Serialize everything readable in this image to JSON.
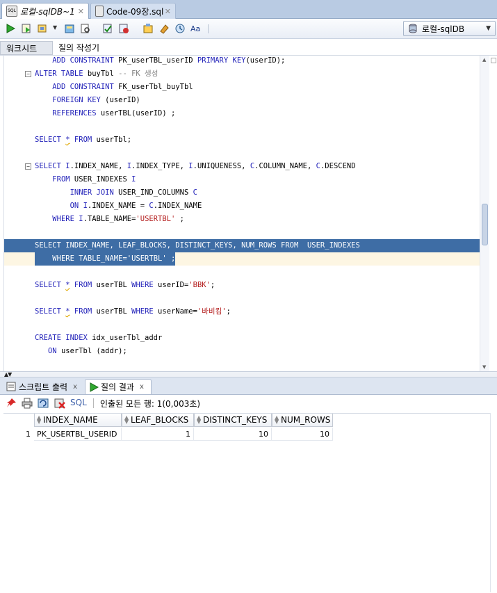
{
  "tabs": [
    {
      "label": "로컬-sqlDB~1",
      "active": true
    },
    {
      "label": "Code-09장.sql",
      "active": false
    }
  ],
  "toolbar": {
    "connection": "로컬-sqlDB"
  },
  "subtabs": [
    "워크시트",
    "질의 작성기"
  ],
  "editor": {
    "lines": [
      {
        "segs": [
          [
            "",
            "    "
          ],
          [
            "kw",
            "ADD CONSTRAINT"
          ],
          [
            "",
            " PK_userTBL_userID "
          ],
          [
            "kw",
            "PRIMARY KEY"
          ],
          [
            "",
            "(userID);"
          ]
        ]
      },
      {
        "fold": true,
        "segs": [
          [
            "kw",
            "ALTER TABLE"
          ],
          [
            "",
            " buyTbl "
          ],
          [
            "cmt",
            "-- FK 생성"
          ]
        ]
      },
      {
        "segs": [
          [
            "",
            "    "
          ],
          [
            "kw",
            "ADD CONSTRAINT"
          ],
          [
            "",
            " FK_userTbl_buyTbl"
          ]
        ]
      },
      {
        "segs": [
          [
            "",
            "    "
          ],
          [
            "kw",
            "FOREIGN KEY"
          ],
          [
            "",
            " (userID)"
          ]
        ]
      },
      {
        "segs": [
          [
            "",
            "    "
          ],
          [
            "kw",
            "REFERENCES"
          ],
          [
            "",
            " userTBL(userID) ;"
          ]
        ]
      },
      {
        "segs": []
      },
      {
        "segs": [
          [
            "kw",
            "SELECT"
          ],
          [
            "",
            " "
          ],
          [
            "star",
            "*"
          ],
          [
            "",
            " "
          ],
          [
            "kw",
            "FROM"
          ],
          [
            "",
            " userTbl;"
          ]
        ]
      },
      {
        "segs": []
      },
      {
        "fold": true,
        "segs": [
          [
            "kw",
            "SELECT"
          ],
          [
            "",
            " "
          ],
          [
            "kw",
            "I"
          ],
          [
            "",
            ".INDEX_NAME, "
          ],
          [
            "kw",
            "I"
          ],
          [
            "",
            ".INDEX_TYPE, "
          ],
          [
            "kw",
            "I"
          ],
          [
            "",
            ".UNIQUENESS, "
          ],
          [
            "kw",
            "C"
          ],
          [
            "",
            ".COLUMN_NAME, "
          ],
          [
            "kw",
            "C"
          ],
          [
            "",
            ".DESCEND"
          ]
        ]
      },
      {
        "segs": [
          [
            "",
            "    "
          ],
          [
            "kw",
            "FROM"
          ],
          [
            "",
            " USER_INDEXES "
          ],
          [
            "kw",
            "I"
          ]
        ]
      },
      {
        "segs": [
          [
            "",
            "        "
          ],
          [
            "kw",
            "INNER JOIN"
          ],
          [
            "",
            " USER_IND_COLUMNS "
          ],
          [
            "kw",
            "C"
          ]
        ]
      },
      {
        "segs": [
          [
            "",
            "        "
          ],
          [
            "kw",
            "ON"
          ],
          [
            "",
            " "
          ],
          [
            "kw",
            "I"
          ],
          [
            "",
            ".INDEX_NAME = "
          ],
          [
            "kw",
            "C"
          ],
          [
            "",
            ".INDEX_NAME"
          ]
        ]
      },
      {
        "segs": [
          [
            "",
            "    "
          ],
          [
            "kw",
            "WHERE"
          ],
          [
            "",
            " "
          ],
          [
            "kw",
            "I"
          ],
          [
            "",
            ".TABLE_NAME="
          ],
          [
            "str",
            "'USERTBL'"
          ],
          [
            "",
            " ;"
          ]
        ]
      },
      {
        "segs": []
      },
      {
        "sel": true,
        "segs": [
          [
            "kw",
            "SELECT"
          ],
          [
            "",
            " INDEX_NAME, LEAF_BLOCKS, DISTINCT_KEYS, NUM_ROWS "
          ],
          [
            "kw",
            "FROM"
          ],
          [
            "",
            "  USER_INDEXES"
          ]
        ]
      },
      {
        "sel": "partial",
        "segs": [
          [
            "",
            "    "
          ],
          [
            "kw",
            "WHERE"
          ],
          [
            "",
            " TABLE_NAME="
          ],
          [
            "str",
            "'USERTBL'"
          ],
          [
            "",
            " ;"
          ]
        ]
      },
      {
        "segs": []
      },
      {
        "segs": [
          [
            "kw",
            "SELECT"
          ],
          [
            "",
            " "
          ],
          [
            "star",
            "*"
          ],
          [
            "",
            " "
          ],
          [
            "kw",
            "FROM"
          ],
          [
            "",
            " userTBL "
          ],
          [
            "kw",
            "WHERE"
          ],
          [
            "",
            " userID="
          ],
          [
            "str",
            "'BBK'"
          ],
          [
            "",
            ";"
          ]
        ]
      },
      {
        "segs": []
      },
      {
        "segs": [
          [
            "kw",
            "SELECT"
          ],
          [
            "",
            " "
          ],
          [
            "star",
            "*"
          ],
          [
            "",
            " "
          ],
          [
            "kw",
            "FROM"
          ],
          [
            "",
            " userTBL "
          ],
          [
            "kw",
            "WHERE"
          ],
          [
            "",
            " userName="
          ],
          [
            "str",
            "'바비킴'"
          ],
          [
            "",
            ";"
          ]
        ]
      },
      {
        "segs": []
      },
      {
        "segs": [
          [
            "kw",
            "CREATE INDEX"
          ],
          [
            "",
            " idx_userTbl_addr"
          ]
        ]
      },
      {
        "segs": [
          [
            "",
            "   "
          ],
          [
            "kw",
            "ON"
          ],
          [
            "",
            " userTbl (addr);"
          ]
        ]
      }
    ]
  },
  "result_tabs": [
    {
      "label": "스크립트 출력",
      "close": "x"
    },
    {
      "label": "질의 결과",
      "close": "x"
    }
  ],
  "result_toolbar": {
    "sql_label": "SQL",
    "message": "인출된 모든 행: 1(0,003초)"
  },
  "grid": {
    "columns": [
      "INDEX_NAME",
      "LEAF_BLOCKS",
      "DISTINCT_KEYS",
      "NUM_ROWS"
    ],
    "rows": [
      {
        "num": "1",
        "cells": [
          "PK_USERTBL_USERID",
          "1",
          "10",
          "10"
        ]
      }
    ]
  }
}
